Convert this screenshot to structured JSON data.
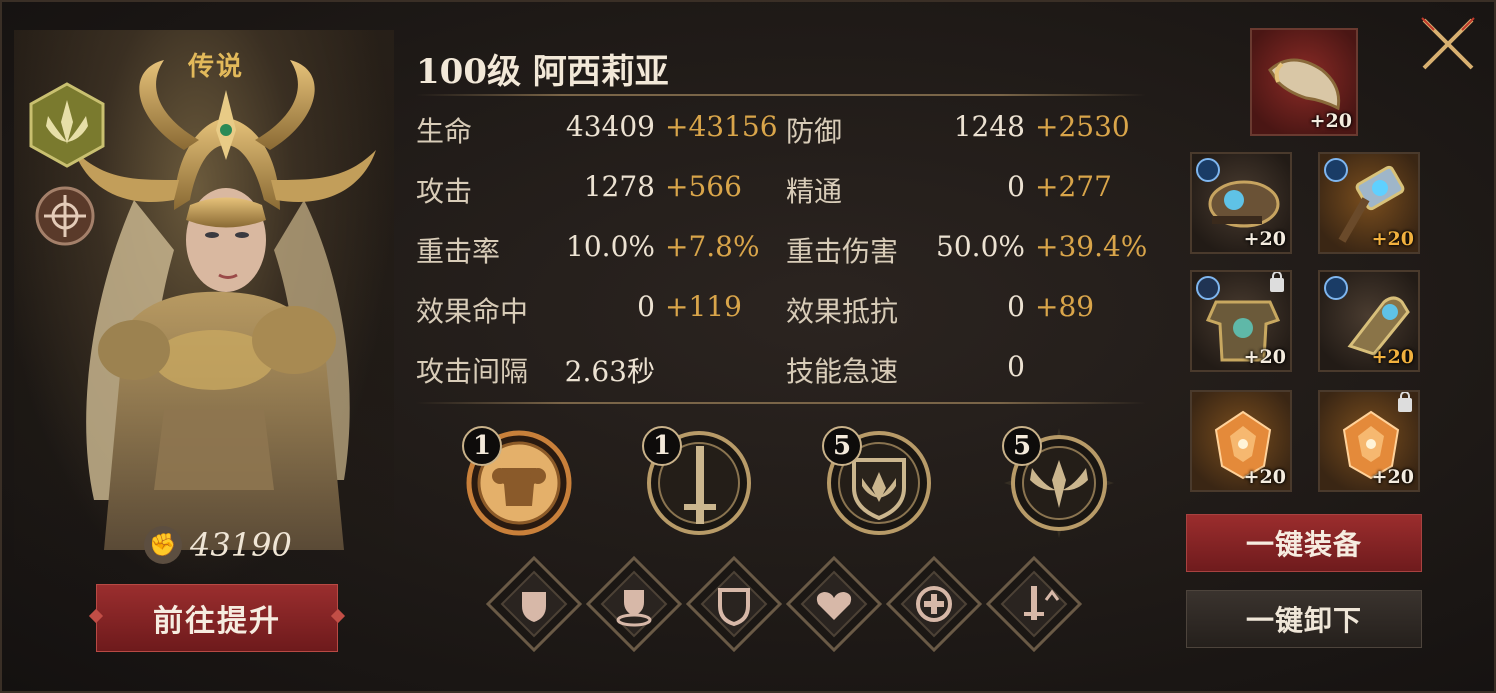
{
  "hero": {
    "rarity": "传说",
    "title": "100级  阿西莉亚",
    "power": "43190",
    "upgrade_label": "前往提升"
  },
  "stats": [
    {
      "label": "生命",
      "base": "43409",
      "bonus": "+43156"
    },
    {
      "label": "防御",
      "base": "1248",
      "bonus": "+2530"
    },
    {
      "label": "攻击",
      "base": "1278",
      "bonus": "+566"
    },
    {
      "label": "精通",
      "base": "0",
      "bonus": "+277"
    },
    {
      "label": "重击率",
      "base": "10.0%",
      "bonus": "+7.8%"
    },
    {
      "label": "重击伤害",
      "base": "50.0%",
      "bonus": "+39.4%"
    },
    {
      "label": "效果命中",
      "base": "0",
      "bonus": "+119"
    },
    {
      "label": "效果抵抗",
      "base": "0",
      "bonus": "+89"
    },
    {
      "label": "攻击间隔",
      "base": "2.63秒",
      "bonus": ""
    },
    {
      "label": "技能急速",
      "base": "0",
      "bonus": ""
    }
  ],
  "skills": [
    {
      "icon": "armor-icon",
      "level": "1"
    },
    {
      "icon": "sword-icon",
      "level": "1"
    },
    {
      "icon": "crest-shield-icon",
      "level": "5"
    },
    {
      "icon": "winged-helm-icon",
      "level": "5"
    }
  ],
  "buffs": [
    "shield-icon",
    "shield-aura-icon",
    "heavy-shield-icon",
    "heart-icon",
    "heal-cycle-icon",
    "weapon-up-icon"
  ],
  "equipment": [
    {
      "icon": "horn-icon",
      "level": "+20"
    },
    {
      "icon": "shield-gauntlet-icon",
      "level": "+20"
    },
    {
      "icon": "hammer-icon",
      "level": "+20"
    },
    {
      "icon": "armor-chest-icon",
      "level": "+20"
    },
    {
      "icon": "gauntlet-icon",
      "level": "+20"
    },
    {
      "icon": "amber-gem-icon",
      "level": "+20"
    },
    {
      "icon": "amber-gem-icon",
      "level": "+20"
    }
  ],
  "actions": {
    "equip_all": "一键装备",
    "unequip_all": "一键卸下"
  }
}
